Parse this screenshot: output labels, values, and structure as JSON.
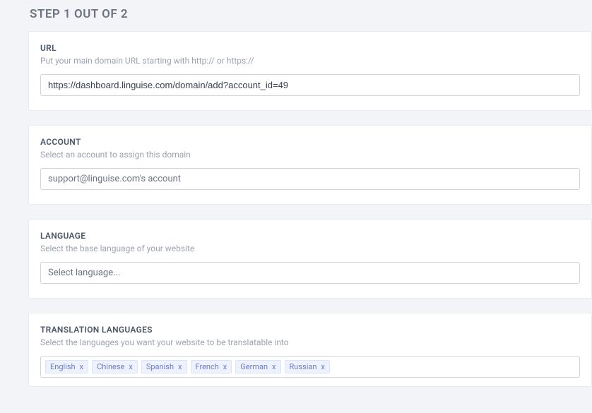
{
  "step_title": "STEP 1 OUT OF 2",
  "url": {
    "label": "URL",
    "help": "Put your main domain URL starting with http:// or https://",
    "value": "https://dashboard.linguise.com/domain/add?account_id=49"
  },
  "account": {
    "label": "ACCOUNT",
    "help": "Select an account to assign this domain",
    "value": "support@linguise.com's account"
  },
  "language": {
    "label": "LANGUAGE",
    "help": "Select the base language of your website",
    "placeholder": "Select language..."
  },
  "translation": {
    "label": "TRANSLATION LANGUAGES",
    "help": "Select the languages you want your website to be translatable into",
    "tags": [
      "English",
      "Chinese",
      "Spanish",
      "French",
      "German",
      "Russian"
    ]
  }
}
